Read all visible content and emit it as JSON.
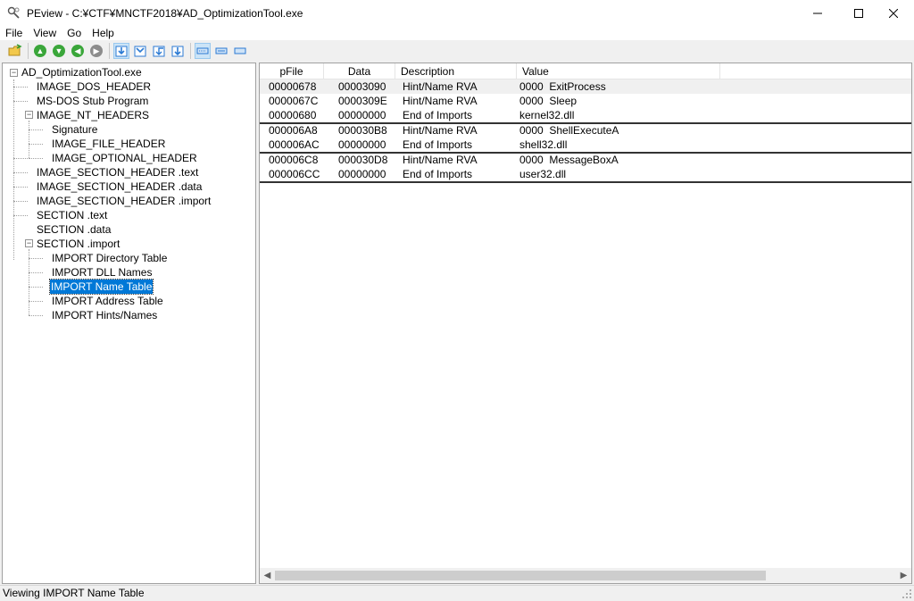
{
  "window": {
    "title": "PEview - C:¥CTF¥MNCTF2018¥AD_OptimizationTool.exe",
    "controls": {
      "minimize": "—",
      "maximize": "☐",
      "close": "✕"
    }
  },
  "menu": [
    {
      "label": "File"
    },
    {
      "label": "View"
    },
    {
      "label": "Go"
    },
    {
      "label": "Help"
    }
  ],
  "toolbar": {
    "icons": [
      "open-icon",
      "up-icon",
      "down-icon",
      "back-icon",
      "forward-icon",
      "view-hex-icon",
      "view-byte-icon",
      "view-dword-icon",
      "view-word-icon",
      "layout-1-icon",
      "layout-2-icon",
      "layout-3-icon"
    ]
  },
  "tree": {
    "items": [
      {
        "label": "AD_OptimizationTool.exe"
      },
      {
        "label": "IMAGE_DOS_HEADER"
      },
      {
        "label": "MS-DOS Stub Program"
      },
      {
        "label": "IMAGE_NT_HEADERS"
      },
      {
        "label": "Signature"
      },
      {
        "label": "IMAGE_FILE_HEADER"
      },
      {
        "label": "IMAGE_OPTIONAL_HEADER"
      },
      {
        "label": "IMAGE_SECTION_HEADER .text"
      },
      {
        "label": "IMAGE_SECTION_HEADER .data"
      },
      {
        "label": "IMAGE_SECTION_HEADER .import"
      },
      {
        "label": "SECTION .text"
      },
      {
        "label": "SECTION .data"
      },
      {
        "label": "SECTION .import"
      },
      {
        "label": "IMPORT Directory Table"
      },
      {
        "label": "IMPORT DLL Names"
      },
      {
        "label": "IMPORT Name Table"
      },
      {
        "label": "IMPORT Address Table"
      },
      {
        "label": "IMPORT Hints/Names"
      }
    ],
    "selected": "IMPORT Name Table"
  },
  "table": {
    "columns": [
      "pFile",
      "Data",
      "Description",
      "Value"
    ],
    "rows": [
      [
        "00000678",
        "00003090",
        "Hint/Name RVA",
        "0000  ExitProcess"
      ],
      [
        "0000067C",
        "0000309E",
        "Hint/Name RVA",
        "0000  Sleep"
      ],
      [
        "00000680",
        "00000000",
        "End of Imports",
        "kernel32.dll"
      ],
      [
        "000006A8",
        "000030B8",
        "Hint/Name RVA",
        "0000  ShellExecuteA"
      ],
      [
        "000006AC",
        "00000000",
        "End of Imports",
        "shell32.dll"
      ],
      [
        "000006C8",
        "000030D8",
        "Hint/Name RVA",
        "0000  MessageBoxA"
      ],
      [
        "000006CC",
        "00000000",
        "End of Imports",
        "user32.dll"
      ]
    ]
  },
  "status": {
    "text": "Viewing IMPORT Name Table"
  },
  "colors": {
    "selection": "#0078d7",
    "green": "#3aa63a",
    "gray": "#8c8c8c",
    "blue": "#2b7ad3"
  }
}
